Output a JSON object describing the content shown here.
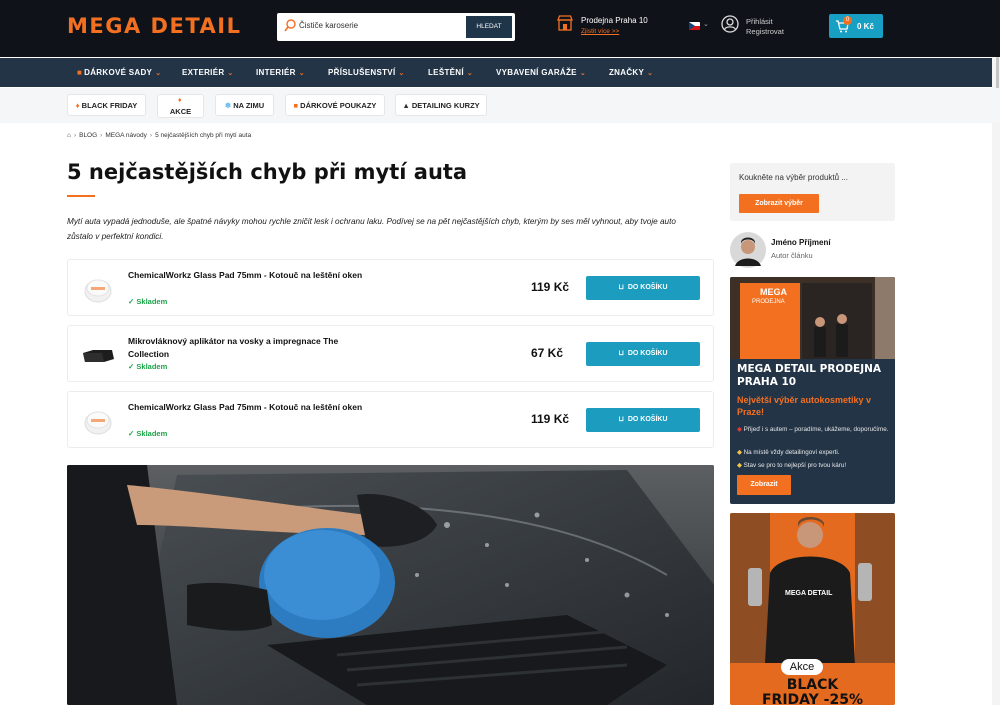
{
  "header": {
    "logo": "MEGA DETAIL",
    "search_value": "Čističe karoserie",
    "search_button": "HLEDAT",
    "store_title": "Prodejna Praha 10",
    "store_link": "Zjistit více >>",
    "login": "Přihlásit",
    "register": "Registrovat",
    "cart_count": "0",
    "cart_amount": "0 Kč"
  },
  "nav": [
    {
      "label": "DÁRKOVÉ SADY"
    },
    {
      "label": "EXTERIÉR"
    },
    {
      "label": "INTERIÉR"
    },
    {
      "label": "PŘÍSLUŠENSTVÍ"
    },
    {
      "label": "LEŠTĚNÍ"
    },
    {
      "label": "VYBAVENÍ GARÁŽE"
    },
    {
      "label": "ZNAČKY"
    }
  ],
  "chips": [
    {
      "label": "BLACK FRIDAY"
    },
    {
      "label": "AKCE"
    },
    {
      "label": "NA ZIMU"
    },
    {
      "label": "DÁRKOVÉ POUKAZY"
    },
    {
      "label": "DETAILING KURZY"
    }
  ],
  "breadcrumb": {
    "home_icon": "home-icon",
    "items": [
      "BLOG",
      "MEGA návody",
      "5 nejčastějších chyb při mytí auta"
    ]
  },
  "article": {
    "title": "5 nejčastějších chyb při mytí auta",
    "intro": "Mytí auta vypadá jednoduše, ale špatné návyky mohou rychle zničit lesk i ochranu laku. Podívej se na pět nejčastějších chyb, kterým by ses měl vyhnout, aby tvoje auto zůstalo v perfektní kondici."
  },
  "products": [
    {
      "name": "ChemicalWorkz Glass Pad 75mm - Kotouč na leštění oken",
      "stock": "Skladem",
      "price": "119 Kč",
      "buy": "DO KOŠÍKU"
    },
    {
      "name": "Mikrovláknový aplikátor na vosky a impregnace The Collection",
      "stock": "Skladem",
      "price": "67 Kč",
      "buy": "DO KOŠÍKU"
    },
    {
      "name": "ChemicalWorkz Glass Pad 75mm - Kotouč na leštění oken",
      "stock": "Skladem",
      "price": "119 Kč",
      "buy": "DO KOŠÍKU"
    }
  ],
  "sidebar": {
    "promo_text": "Koukněte na výběr produktů ...",
    "promo_button": "Zobrazit výběr",
    "author_name": "Jméno Příjmení",
    "author_role": "Autor článku",
    "store_sign": "MEGA",
    "store_sign2": "PRODEJNA",
    "store_title": "MEGA DETAIL PRODEJNA PRAHA 10",
    "store_subtitle": "Největší výběr autokosmetiky v Praze!",
    "store_bullets": [
      "Přijeď i s autem – poradíme, ukážeme, doporučíme.",
      "Na místě vždy detailingoví experti.",
      "Stav se pro to nejlepší pro tvou káru!"
    ],
    "store_button": "Zobrazit",
    "bf_shirt": "MEGA DETAIL",
    "bf_badge": "Akce",
    "bf_title": "BLACK",
    "bf_title2": "FRIDAY -25%"
  },
  "colors": {
    "brand_orange": "#f37021",
    "dark": "#0f1319",
    "nav": "#233447",
    "cta_blue": "#1c9dbf",
    "in_stock": "#1ea34a"
  }
}
